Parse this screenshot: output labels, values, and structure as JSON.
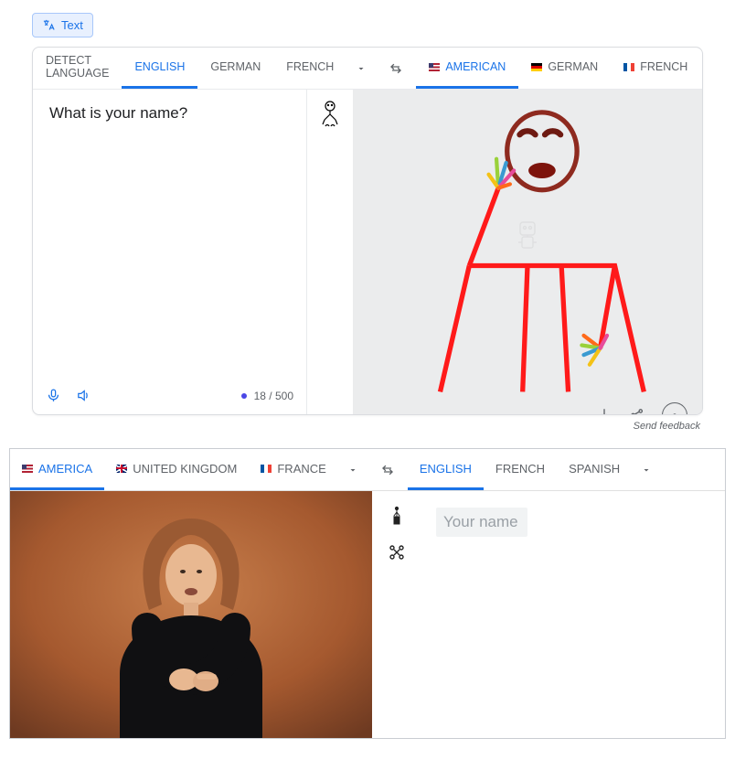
{
  "panel1": {
    "text_chip_label": "Text",
    "source_tabs": {
      "detect": "DETECT LANGUAGE",
      "english": "ENGLISH",
      "german": "GERMAN",
      "french": "FRENCH"
    },
    "target_tabs": {
      "american": "AMERICAN",
      "german": "GERMAN",
      "french": "FRENCH"
    },
    "input_text": "What is your name?",
    "char_count": "18 / 500",
    "feedback_label": "Send feedback"
  },
  "panel2": {
    "source_tabs": {
      "america": "AMERICA",
      "uk": "UNITED KINGDOM",
      "france": "FRANCE"
    },
    "target_tabs": {
      "english": "ENGLISH",
      "french": "FRENCH",
      "spanish": "SPANISH"
    },
    "output_text": "Your name"
  }
}
